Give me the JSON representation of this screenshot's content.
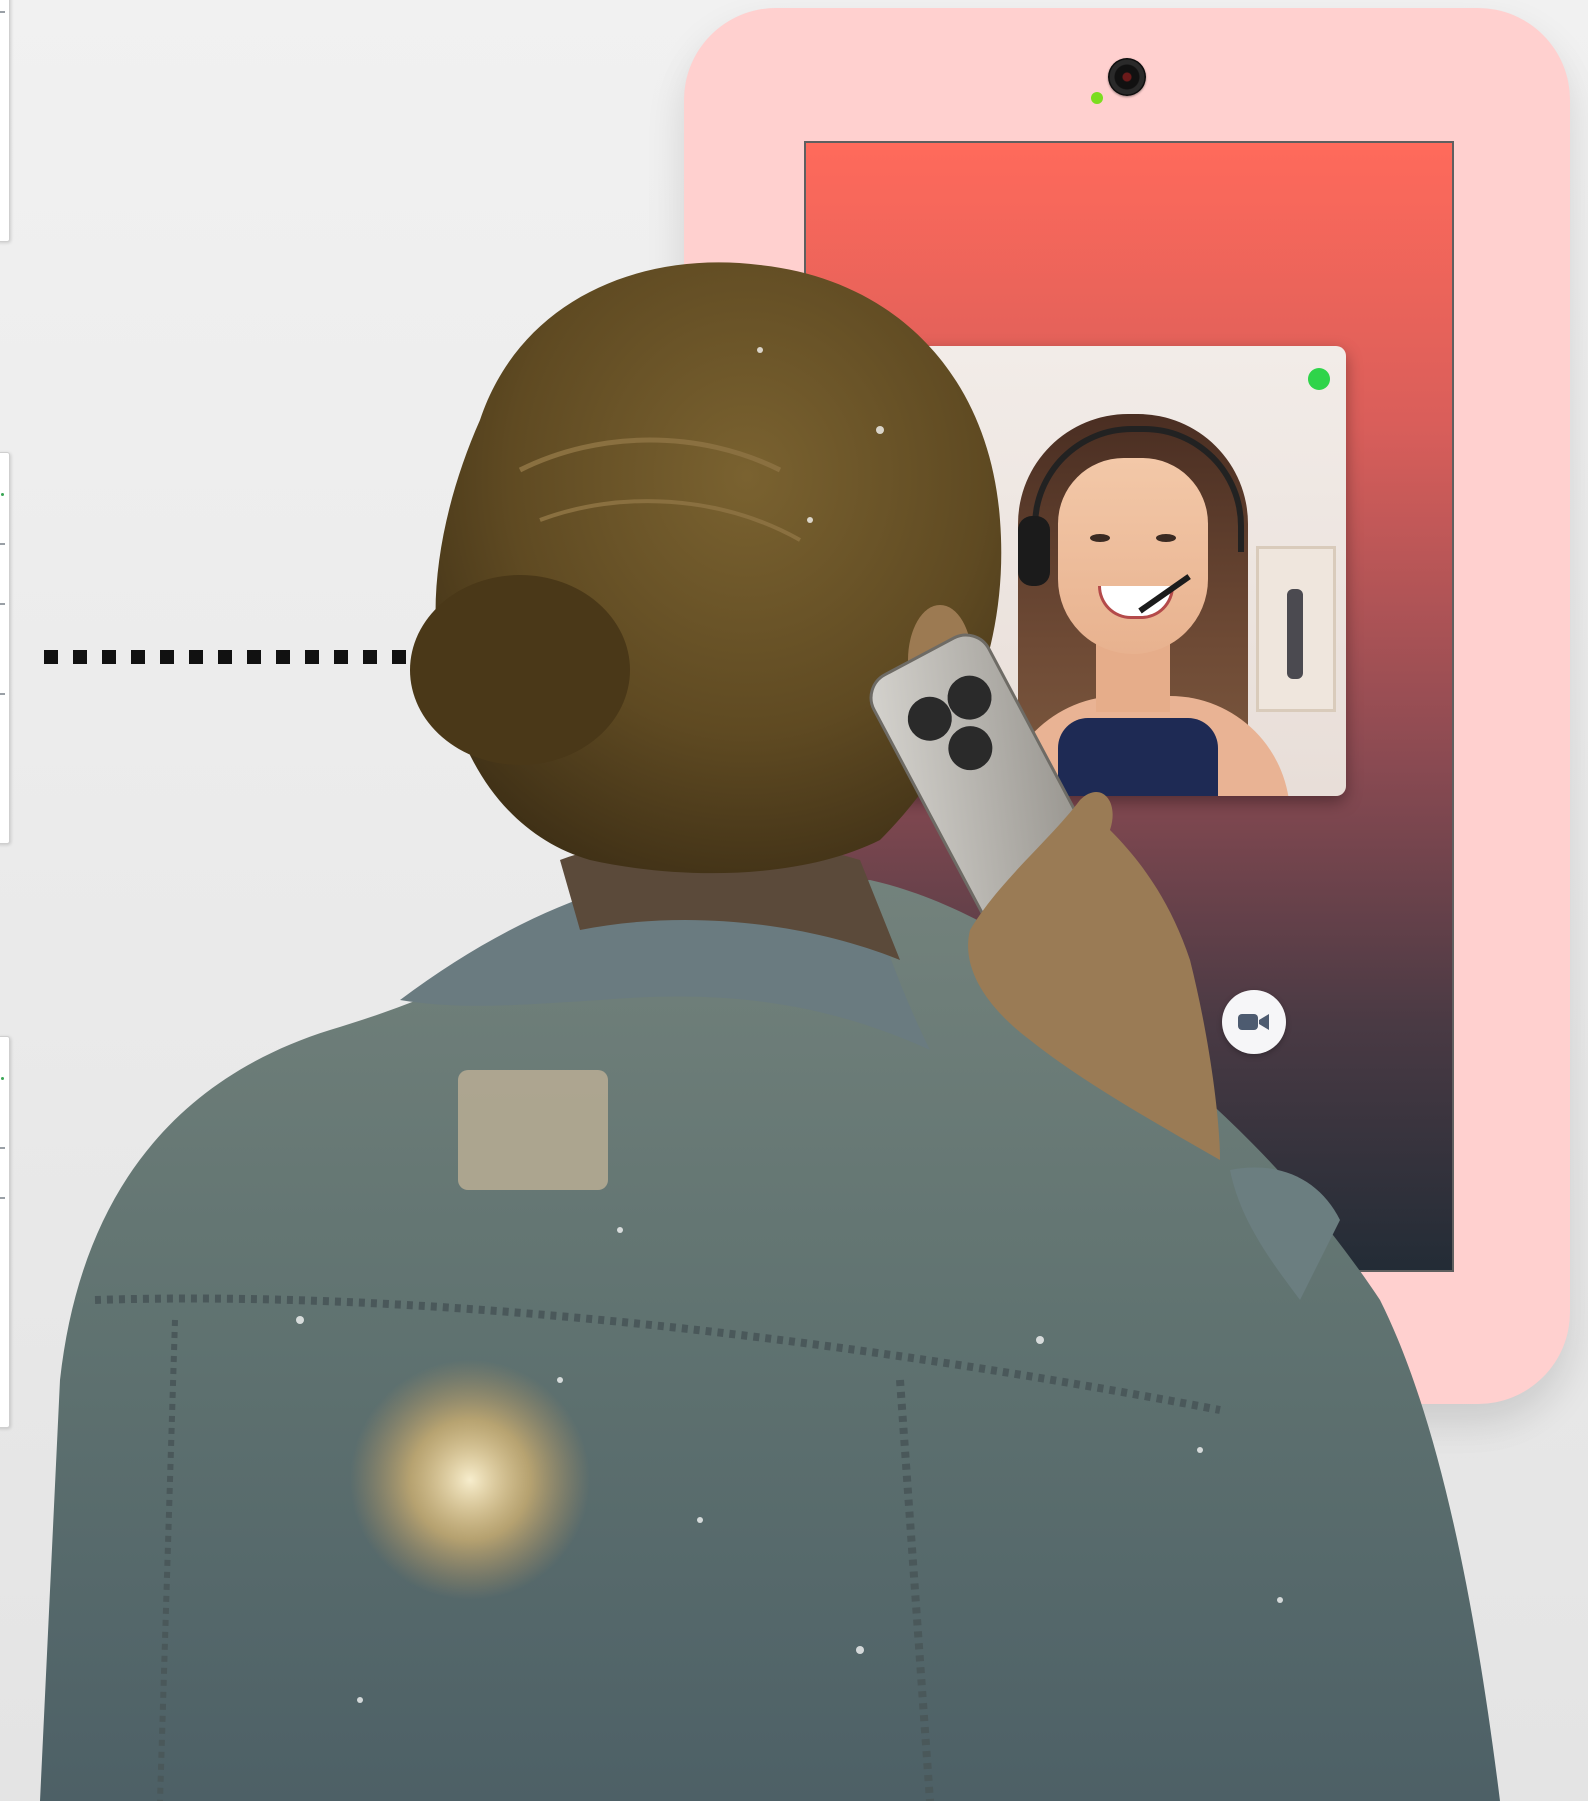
{
  "scene": {
    "description_icons": [
      "camera-icon",
      "video-camera-icon",
      "phone-icon"
    ],
    "colors": {
      "tablet_frame": "#ffd0cf",
      "screen_top": "#ff6a5b",
      "screen_bottom": "#232c36",
      "live_indicator": "#2fd44a",
      "camera_led": "#7bdd1f",
      "connector": "#111111",
      "jacket": "#5f7270",
      "hair": "#6a5024"
    }
  }
}
